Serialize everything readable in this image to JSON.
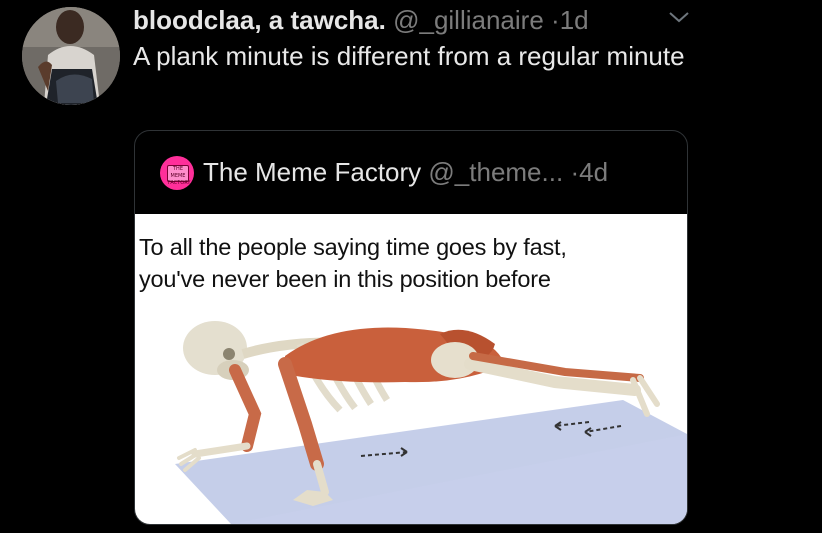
{
  "tweet": {
    "display_name": "bloodclaa, a tawcha.",
    "handle": "@_gillianaire",
    "separator": "·",
    "time": "1d",
    "text": "A plank minute is different from a regular minute",
    "menu_icon": "chevron-down-icon"
  },
  "quoted_tweet": {
    "display_name": "The Meme Factory",
    "handle": "@_theme...",
    "separator": "·",
    "time": "4d",
    "avatar_text": "THE MEME FACTORY",
    "avatar_color": "#ff2f9a",
    "media": {
      "caption_line1": "To all the people saying time goes by fast,",
      "caption_line2": "you've never been in this position before"
    }
  },
  "colors": {
    "background": "#000000",
    "primary_text": "#e8e8e8",
    "secondary_text": "#7c7c7c",
    "border": "#2f3336"
  }
}
